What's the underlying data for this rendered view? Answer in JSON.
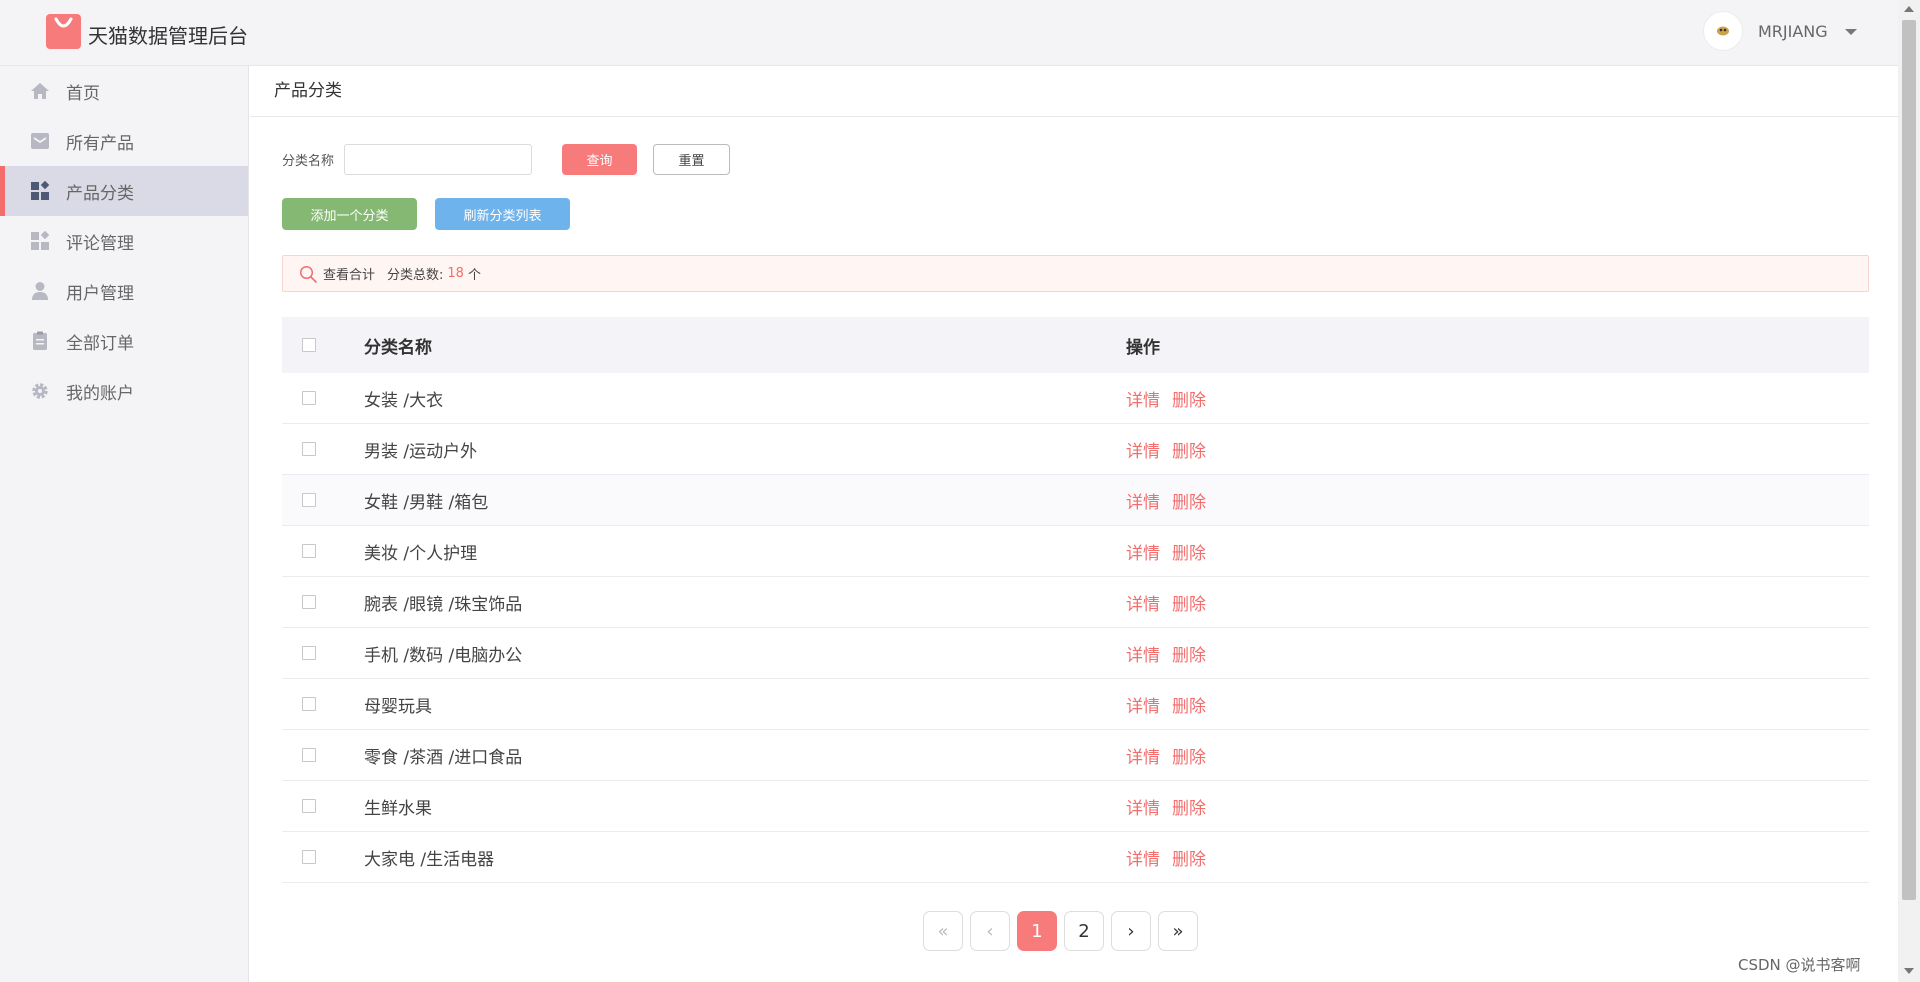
{
  "header": {
    "app_title": "天猫数据管理后台",
    "user": {
      "avatar_alt": "",
      "name": "MRJIANG"
    }
  },
  "sidebar": {
    "items": [
      {
        "label": "首页",
        "icon": "home-icon",
        "active": false
      },
      {
        "label": "所有产品",
        "icon": "envelope-icon",
        "active": false
      },
      {
        "label": "产品分类",
        "icon": "category-grid-icon",
        "active": true
      },
      {
        "label": "评论管理",
        "icon": "comment-grid-icon",
        "active": false
      },
      {
        "label": "用户管理",
        "icon": "user-icon",
        "active": false
      },
      {
        "label": "全部订单",
        "icon": "clipboard-icon",
        "active": false
      },
      {
        "label": "我的账户",
        "icon": "gear-icon",
        "active": false
      }
    ]
  },
  "main": {
    "page_title": "产品分类",
    "filter": {
      "label": "分类名称",
      "value": "",
      "placeholder": "",
      "query_label": "查询",
      "reset_label": "重置"
    },
    "actions": {
      "add_label": "添加一个分类",
      "refresh_label": "刷新分类列表"
    },
    "summary": {
      "view_label": "查看合计",
      "count_label": "分类总数:",
      "count": "18",
      "unit": "个"
    },
    "table": {
      "headers": {
        "name": "分类名称",
        "ops": "操作"
      },
      "rows": [
        {
          "name": "女装 /大衣"
        },
        {
          "name": "男装 /运动户外"
        },
        {
          "name": "女鞋 /男鞋 /箱包"
        },
        {
          "name": "美妆 /个人护理"
        },
        {
          "name": "腕表 /眼镜 /珠宝饰品"
        },
        {
          "name": "手机 /数码 /电脑办公"
        },
        {
          "name": "母婴玩具"
        },
        {
          "name": "零食 /茶酒 /进口食品"
        },
        {
          "name": "生鲜水果"
        },
        {
          "name": "大家电 /生活电器"
        }
      ],
      "op_detail": "详情",
      "op_delete": "删除"
    },
    "pagination": {
      "first": "«",
      "prev": "‹",
      "pages": [
        "1",
        "2"
      ],
      "current": "1",
      "next": "›",
      "last": "»"
    }
  },
  "watermark": "CSDN @说书客啊",
  "colors": {
    "accent": "#f77b7b",
    "green": "#85b973",
    "blue": "#6fb3ec",
    "sidebar_bg": "#f4f4f7",
    "active_bg": "#dadae6"
  }
}
